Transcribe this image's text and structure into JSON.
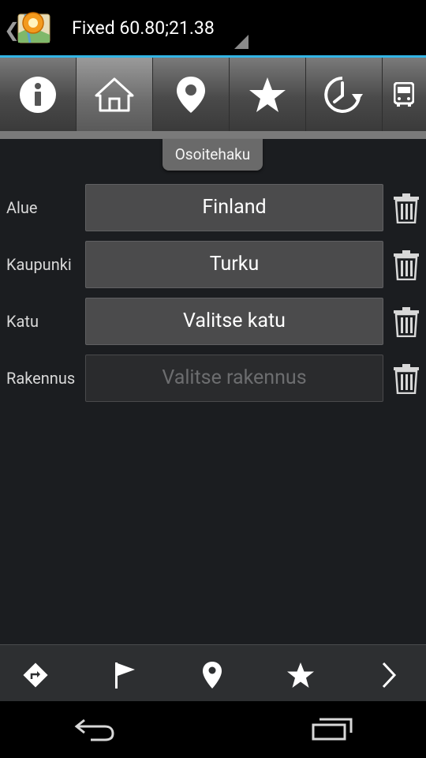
{
  "action_bar": {
    "title": "Fixed 60.80;21.38",
    "back_glyph": "❮",
    "app_icon": "map-pin-app-icon"
  },
  "tabs": [
    {
      "name": "info",
      "icon": "info-icon",
      "active": false
    },
    {
      "name": "home",
      "icon": "home-icon",
      "active": true
    },
    {
      "name": "place",
      "icon": "map-pin-icon",
      "active": false
    },
    {
      "name": "favorites",
      "icon": "star-icon",
      "active": false
    },
    {
      "name": "history",
      "icon": "clock-arrow-icon",
      "active": false
    },
    {
      "name": "transit",
      "icon": "bus-icon",
      "active": false
    }
  ],
  "tooltip": "Osoitehaku",
  "form": {
    "rows": [
      {
        "label": "Alue",
        "value": "Finland",
        "enabled": true
      },
      {
        "label": "Kaupunki",
        "value": "Turku",
        "enabled": true
      },
      {
        "label": "Katu",
        "value": "Valitse katu",
        "enabled": true
      },
      {
        "label": "Rakennus",
        "value": "Valitse rakennus",
        "enabled": false
      }
    ]
  },
  "bottom_bar": [
    {
      "icon": "route-icon"
    },
    {
      "icon": "flag-icon"
    },
    {
      "icon": "map-pin-icon"
    },
    {
      "icon": "star-icon"
    },
    {
      "icon": "chevron-right-icon"
    }
  ],
  "nav": {
    "back": "back-icon",
    "recents": "recent-apps-icon"
  },
  "colors": {
    "accent": "#33b5e5",
    "background": "#1b1d20",
    "field": "#4b4b4c"
  }
}
